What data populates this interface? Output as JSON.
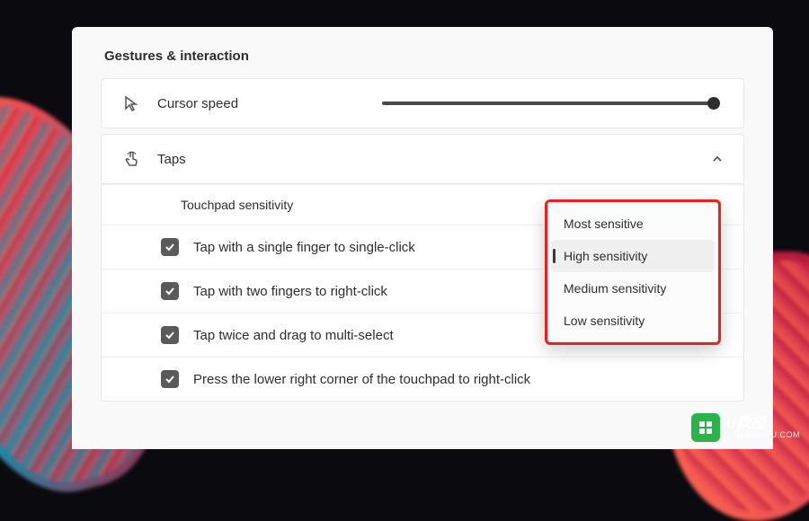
{
  "section_title": "Gestures & interaction",
  "cursor_speed": {
    "label": "Cursor speed",
    "icon": "cursor-icon"
  },
  "taps": {
    "label": "Taps",
    "icon": "tap-icon",
    "sensitivity_label": "Touchpad sensitivity",
    "options": [
      {
        "label": "Tap with a single finger to single-click",
        "checked": true
      },
      {
        "label": "Tap with two fingers to right-click",
        "checked": true
      },
      {
        "label": "Tap twice and drag to multi-select",
        "checked": true
      },
      {
        "label": "Press the lower right corner of the touchpad to right-click",
        "checked": true
      }
    ]
  },
  "sensitivity_dropdown": {
    "items": [
      {
        "label": "Most sensitive",
        "selected": false
      },
      {
        "label": "High sensitivity",
        "selected": true
      },
      {
        "label": "Medium sensitivity",
        "selected": false
      },
      {
        "label": "Low sensitivity",
        "selected": false
      }
    ]
  },
  "watermark": {
    "brand": "U教授",
    "url": "UJIAOSHOU.COM"
  }
}
